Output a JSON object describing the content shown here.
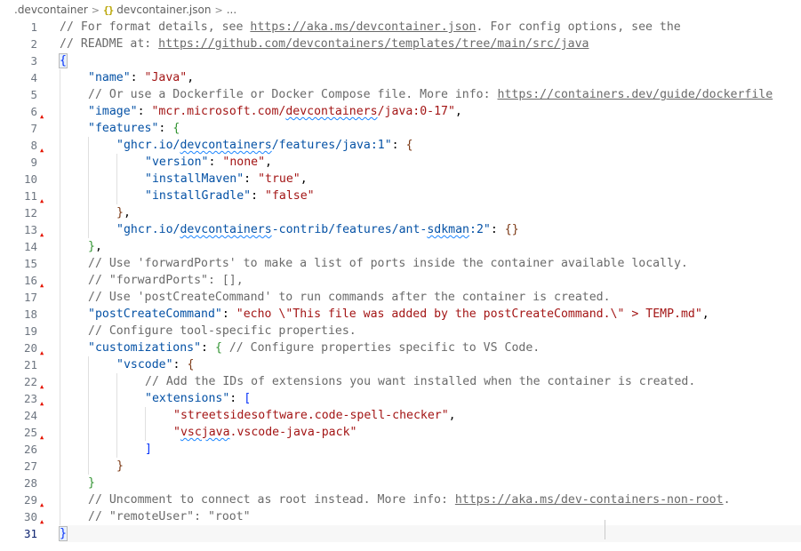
{
  "breadcrumb": {
    "folder": ".devcontainer",
    "file": "devcontainer.json",
    "ellipsis": "...",
    "icon": "json-braces-icon"
  },
  "editor": {
    "current_line": 31,
    "lines": [
      "// For format details, see https://aka.ms/devcontainer.json. For config options, see the",
      "// README at: https://github.com/devcontainers/templates/tree/main/src/java",
      "{",
      "\t\"name\": \"Java\",",
      "\t// Or use a Dockerfile or Docker Compose file. More info: https://containers.dev/guide/dockerfile",
      "\t\"image\": \"mcr.microsoft.com/devcontainers/java:0-17\",",
      "\t\"features\": {",
      "\t\t\"ghcr.io/devcontainers/features/java:1\": {",
      "\t\t\t\"version\": \"none\",",
      "\t\t\t\"installMaven\": \"true\",",
      "\t\t\t\"installGradle\": \"false\"",
      "\t\t},",
      "\t\t\"ghcr.io/devcontainers-contrib/features/ant-sdkman:2\": {}",
      "\t},",
      "\t// Use 'forwardPorts' to make a list of ports inside the container available locally.",
      "\t// \"forwardPorts\": [],",
      "\t// Use 'postCreateCommand' to run commands after the container is created.",
      "\t\"postCreateCommand\": \"echo \\\"This file was added by the postCreateCommand.\\\" > TEMP.md\",",
      "\t// Configure tool-specific properties.",
      "\t\"customizations\": { // Configure properties specific to VS Code.",
      "\t\t\"vscode\": {",
      "\t\t\t// Add the IDs of extensions you want installed when the container is created.",
      "\t\t\t\"extensions\": [",
      "\t\t\t\t\"streetsidesoftware.code-spell-checker\",",
      "\t\t\t\t\"vscjava.vscode-java-pack\"",
      "\t\t\t]",
      "\t\t}",
      "\t}",
      "\t// Uncomment to connect as root instead. More info: https://aka.ms/dev-containers-non-root.",
      "\t// \"remoteUser\": \"root\"",
      "}"
    ]
  },
  "colors": {
    "comment": "#6a6a6a",
    "key": "#0451a5",
    "string": "#a31515",
    "line_number": "#6e7681",
    "marker": "#e51400"
  }
}
